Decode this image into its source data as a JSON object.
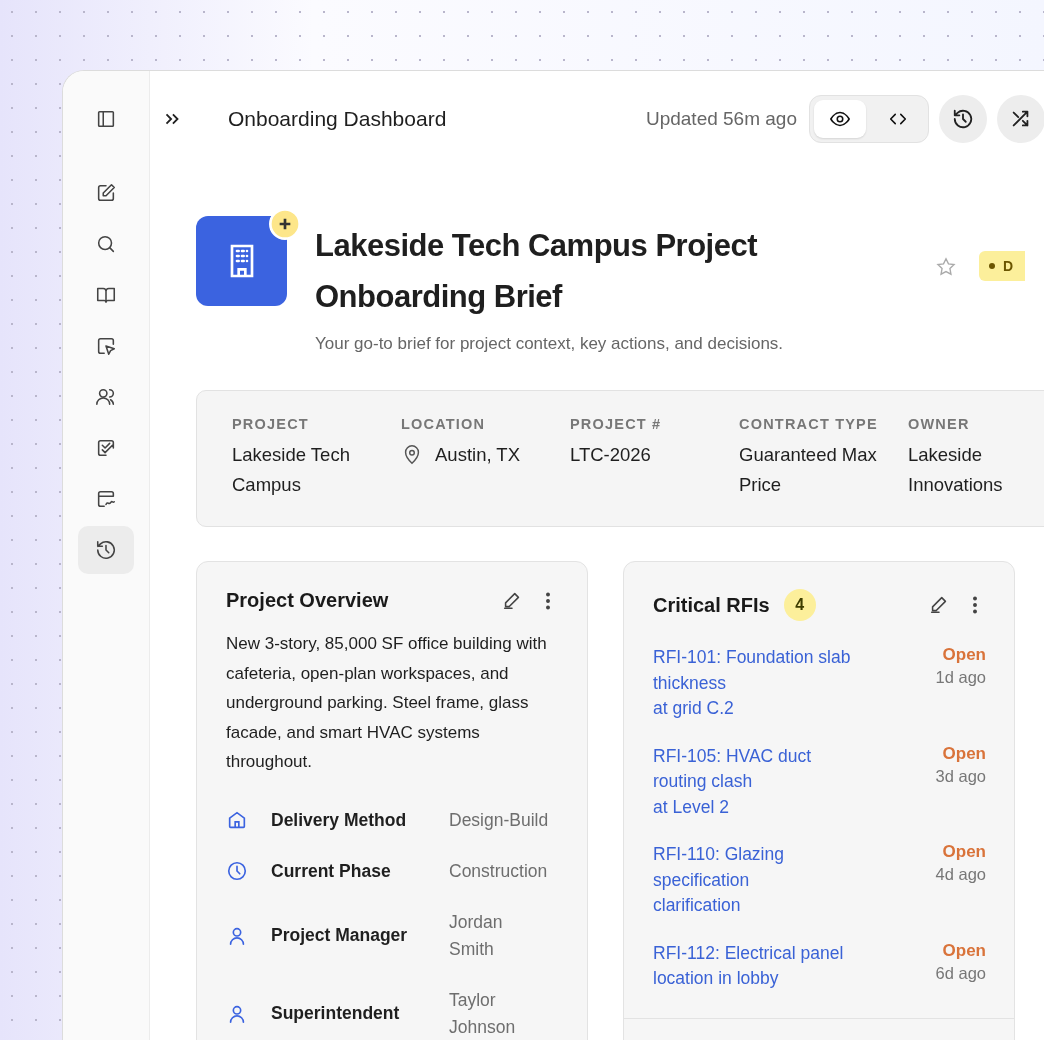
{
  "sidebar": {
    "items": [
      {
        "selected": false
      },
      {
        "selected": false
      },
      {
        "selected": false
      },
      {
        "selected": false
      },
      {
        "selected": false
      },
      {
        "selected": false
      },
      {
        "selected": false
      },
      {
        "selected": false
      },
      {
        "selected": true
      }
    ]
  },
  "header": {
    "title": "Onboarding Dashboard",
    "updated": "Updated 56m ago",
    "view_toggle": [
      {
        "selected": true
      },
      {
        "selected": false
      }
    ]
  },
  "brief": {
    "title": "Lakeside Tech Campus Project Onboarding Brief",
    "subtitle": "Your go-to brief for project context, key actions, and decisions.",
    "starred": false,
    "status_badge": "D"
  },
  "info": [
    {
      "label": "PROJECT",
      "value": "Lakeside Tech Campus"
    },
    {
      "label": "LOCATION",
      "value": "Austin, TX"
    },
    {
      "label": "PROJECT #",
      "value": "LTC-2026"
    },
    {
      "label": "CONTRACT TYPE",
      "value": "Guaranteed Max Price"
    },
    {
      "label": "OWNER",
      "value": "Lakeside Innovations"
    }
  ],
  "overview": {
    "title": "Project Overview",
    "description": "New 3-story, 85,000 SF office building with cafeteria, open-plan workspaces, and underground parking. Steel frame, glass facade, and smart HVAC systems throughout.",
    "details": [
      {
        "label": "Delivery Method",
        "value": "Design-Build"
      },
      {
        "label": "Current Phase",
        "value": "Construction"
      },
      {
        "label": "Project Manager",
        "value": "Jordan Smith"
      },
      {
        "label": "Superintendent",
        "value": "Taylor Johnson"
      }
    ]
  },
  "rfis": {
    "title": "Critical RFIs",
    "count": "4",
    "items": [
      {
        "title": "RFI-101: Foundation slab thickness",
        "title_2": "at grid C.2",
        "status": "Open",
        "age": "1d ago"
      },
      {
        "title": "RFI-105: HVAC duct routing clash",
        "title_2": "at Level 2",
        "status": "Open",
        "age": "3d ago"
      },
      {
        "title": "RFI-110: Glazing specification",
        "title_2": "clarification",
        "status": "Open",
        "age": "4d ago"
      },
      {
        "title": "RFI-112: Electrical panel location in lobby",
        "status": "Open",
        "age": "6d ago"
      }
    ]
  }
}
